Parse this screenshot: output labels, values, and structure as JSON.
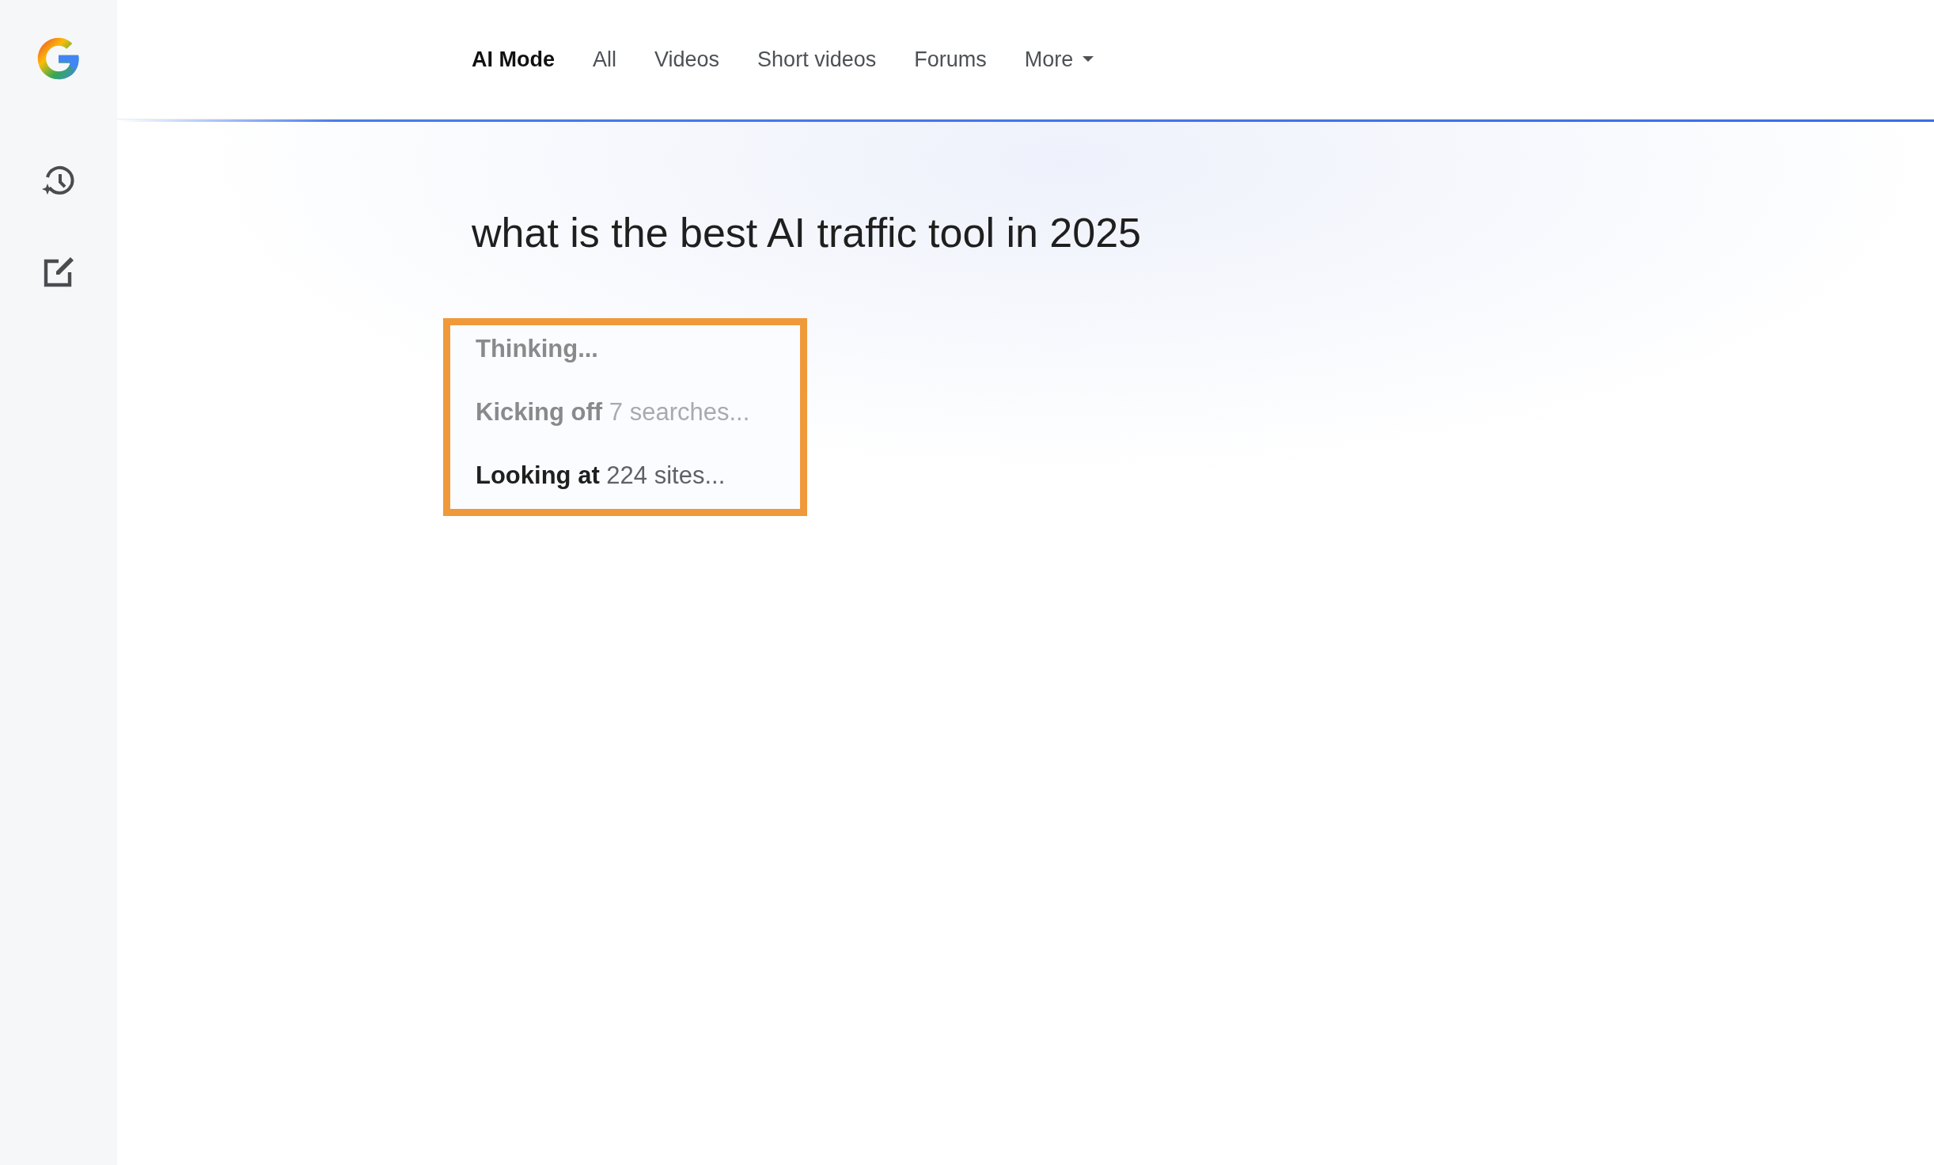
{
  "tabs": [
    {
      "label": "AI Mode",
      "selected": true,
      "kind": "tab"
    },
    {
      "label": "All",
      "selected": false,
      "kind": "tab"
    },
    {
      "label": "Videos",
      "selected": false,
      "kind": "tab"
    },
    {
      "label": "Short videos",
      "selected": false,
      "kind": "tab"
    },
    {
      "label": "Forums",
      "selected": false,
      "kind": "tab"
    },
    {
      "label": "More",
      "selected": false,
      "kind": "menu"
    }
  ],
  "query": "what is the best AI traffic tool in 2025",
  "progress": {
    "highlighted": true,
    "steps": [
      {
        "action": "Thinking...",
        "active": false
      },
      {
        "action": "Kicking off",
        "detail": "7 searches...",
        "active": false
      },
      {
        "action": "Looking at",
        "detail": "224 sites...",
        "active": true
      }
    ]
  }
}
